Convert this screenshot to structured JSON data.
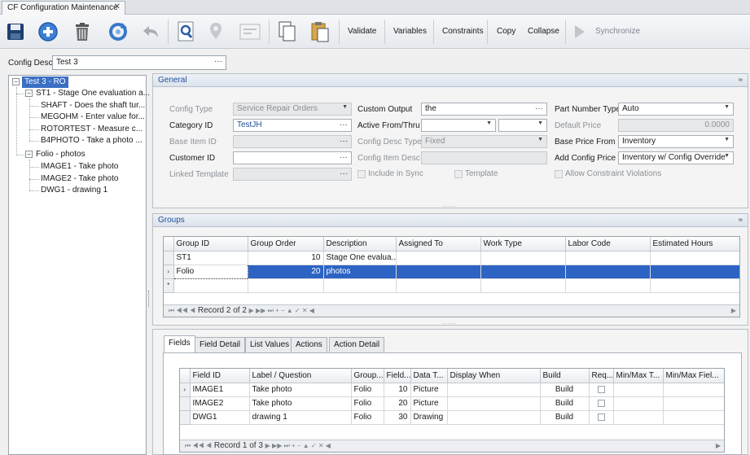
{
  "tab": {
    "title": "CF Configuration Maintenance",
    "close": "✕"
  },
  "toolbar": {
    "icons": [
      "save-icon",
      "add-icon",
      "delete-icon",
      "refresh-icon",
      "undo-icon",
      "find-icon",
      "location-icon",
      "message-icon",
      "copy-icon",
      "paste-icon"
    ],
    "validate": "Validate",
    "variables": "Variables",
    "constraints": "Constraints",
    "copy": "Copy",
    "collapse": "Collapse",
    "synchronize": "Synchronize"
  },
  "config_desc": {
    "label": "Config Desc",
    "value": "Test 3",
    "ellipsis": "···"
  },
  "tree": {
    "root": "Test 3 - RO",
    "groups": [
      {
        "label": "ST1 - Stage One evaluation a...",
        "children": [
          "SHAFT - Does the shaft tur...",
          "MEGOHM - Enter value for...",
          "ROTORTEST - Measure c...",
          "B4PHOTO - Take a photo ..."
        ]
      },
      {
        "label": "Folio - photos",
        "children": [
          "IMAGE1 - Take photo",
          "IMAGE2 - Take photo",
          "DWG1 - drawing 1"
        ]
      }
    ],
    "expander": "−"
  },
  "general": {
    "title": "General",
    "collapse_glyph": "≈",
    "config_type": {
      "label": "Config Type",
      "value": "Service Repair Orders"
    },
    "category_id": {
      "label": "Category ID",
      "value": "TestJH"
    },
    "base_item_id": {
      "label": "Base Item ID",
      "value": ""
    },
    "customer_id": {
      "label": "Customer ID",
      "value": ""
    },
    "linked_template": {
      "label": "Linked Template",
      "value": ""
    },
    "custom_output": {
      "label": "Custom Output",
      "value": "the"
    },
    "active_from_thru": {
      "label": "Active From/Thru"
    },
    "config_desc_type": {
      "label": "Config Desc Type",
      "value": "Fixed"
    },
    "config_item_desc": {
      "label": "Config Item Desc",
      "value": ""
    },
    "include_in_sync": "Include in Sync",
    "template": "Template",
    "part_number_type": {
      "label": "Part Number Type",
      "value": "Auto"
    },
    "default_price": {
      "label": "Default Price",
      "value": "0.0000"
    },
    "base_price_from": {
      "label": "Base Price From",
      "value": "Inventory"
    },
    "add_config_price": {
      "label": "Add Config Price",
      "value": "Inventory w/ Config Override"
    },
    "allow_constraint_violations": "Allow Constraint Violations"
  },
  "splitter_glyph": "·····",
  "groups": {
    "title": "Groups",
    "collapse_glyph": "≈",
    "columns": [
      "Group ID",
      "Group Order",
      "Description",
      "Assigned To",
      "Work Type",
      "Labor Code",
      "Estimated Hours"
    ],
    "rows": [
      {
        "indicator": "",
        "group_id": "ST1",
        "order": "10",
        "description": "Stage One evalua..."
      },
      {
        "indicator": "›",
        "group_id": "Folio",
        "order": "20",
        "description": "photos"
      }
    ],
    "new_row_indicator": "*",
    "record": "Record 2 of 2"
  },
  "fields_section": {
    "tabs": [
      "Fields",
      "Field Detail",
      "List Values",
      "Actions",
      "Action Detail"
    ],
    "columns": [
      "Field ID",
      "Label / Question",
      "Group...",
      "Field...",
      "Data T...",
      "Display When",
      "Build",
      "Req...",
      "Min/Max T...",
      "Min/Max Fiel..."
    ],
    "rows": [
      {
        "indicator": "›",
        "field_id": "IMAGE1",
        "label": "Take photo",
        "group": "Folio",
        "field": "10",
        "data_type": "Picture",
        "display_when": "",
        "build": "Build"
      },
      {
        "indicator": "",
        "field_id": "IMAGE2",
        "label": "Take photo",
        "group": "Folio",
        "field": "20",
        "data_type": "Picture",
        "display_when": "",
        "build": "Build"
      },
      {
        "indicator": "",
        "field_id": "DWG1",
        "label": "drawing 1",
        "group": "Folio",
        "field": "30",
        "data_type": "Drawing",
        "display_when": "",
        "build": "Build"
      }
    ],
    "record": "Record 1 of 3"
  },
  "colors": {
    "accent": "#2d64c4",
    "panel_title": "#1f4e9c"
  }
}
